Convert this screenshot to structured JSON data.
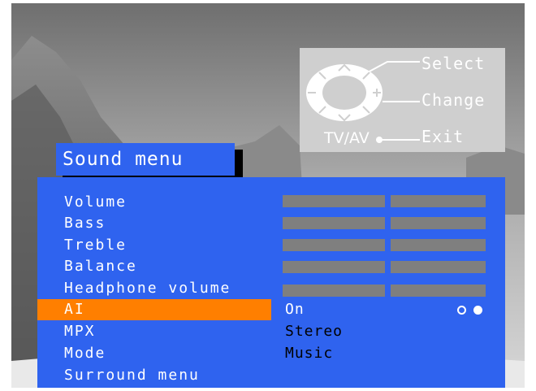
{
  "help": {
    "select_label": "Select",
    "change_label": "Change",
    "exit_label": "Exit",
    "tvav_label": "TV/AV"
  },
  "menu": {
    "title": "Sound menu",
    "items": [
      {
        "label": "Volume"
      },
      {
        "label": "Bass"
      },
      {
        "label": "Treble"
      },
      {
        "label": "Balance"
      },
      {
        "label": "Headphone volume"
      },
      {
        "label": "AI",
        "value": "On",
        "selected": true
      },
      {
        "label": "MPX",
        "value": "Stereo"
      },
      {
        "label": "Mode",
        "value": "Music"
      },
      {
        "label": "Surround menu"
      }
    ]
  },
  "colors": {
    "panel": "#2f63ef",
    "highlight": "#ff7f00",
    "bar": "#7f7f7f",
    "help_box": "#cfcfcf"
  }
}
